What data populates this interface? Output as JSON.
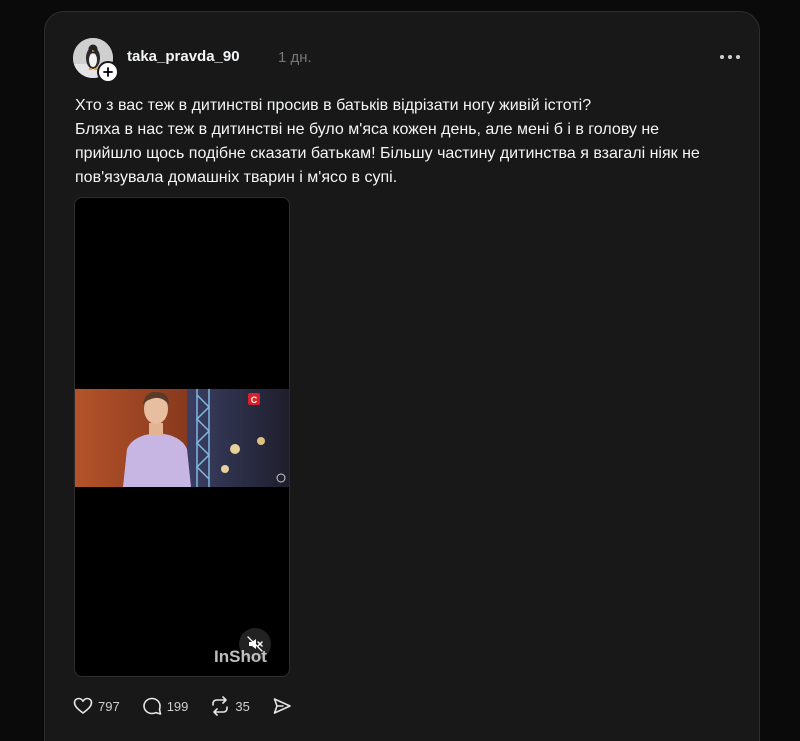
{
  "post": {
    "username": "taka_pravda_90",
    "time": "1 дн.",
    "text_lines": [
      "Хто з вас теж в дитинстві просив в батьків відрізати ногу живій істоті?",
      "Бляха в нас теж в дитинстві не було м'яса кожен день, але мені б і в голову не",
      "прийшло щось подібне сказати батькам! Більшу частину дитинства я взагалі ніяк не",
      "пов'язувала домашніх тварин і м'ясо в супі."
    ],
    "video": {
      "watermark": "InShot",
      "muted": true,
      "channel_logo_icon": "stb-channel-logo-icon"
    }
  },
  "actions": {
    "likes": "797",
    "comments": "199",
    "reposts": "35",
    "share_icon": "send-icon"
  },
  "colors": {
    "background": "#0a0a0a",
    "card": "#181818",
    "text": "#f3f5f7",
    "muted": "#777777"
  }
}
